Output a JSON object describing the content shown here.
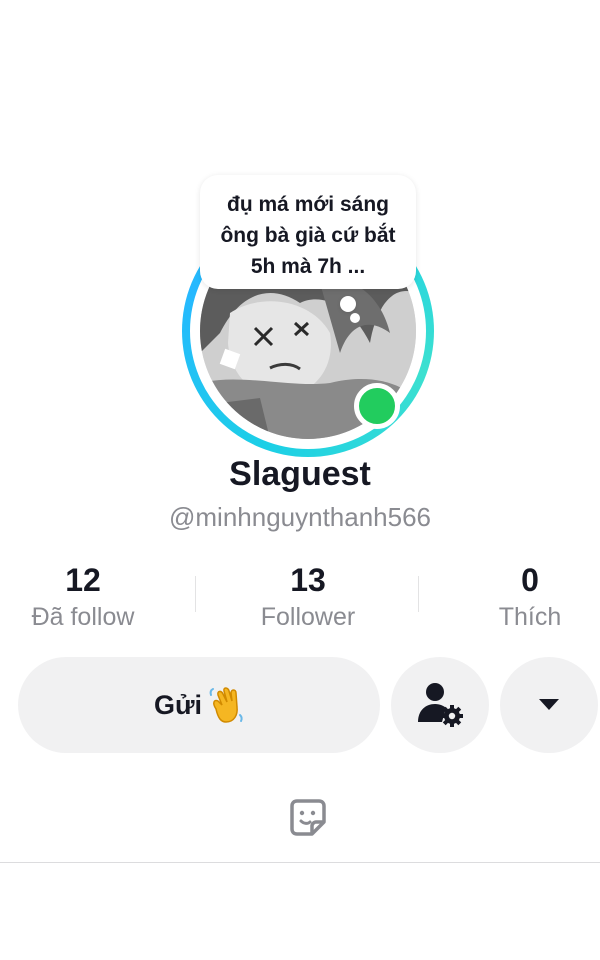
{
  "profile": {
    "note": "đụ má mới sáng ông bà già cứ bắt 5h mà 7h ...",
    "display_name": "Slaguest",
    "username": "@minhnguynthanh566",
    "online": true
  },
  "stats": [
    {
      "value": "12",
      "label": "Đã follow"
    },
    {
      "value": "13",
      "label": "Follower"
    },
    {
      "value": "0",
      "label": "Thích"
    }
  ],
  "actions": {
    "message_label": "Gửi",
    "message_icon": "waving-hand-icon",
    "settings_icon": "person-settings-icon",
    "more_icon": "triangle-down-icon"
  },
  "tabs": {
    "active_icon": "sticker-icon"
  },
  "colors": {
    "ring": "#1ccfe6",
    "online": "#22cc5e",
    "text_primary": "#161823",
    "text_secondary": "#8a8b91",
    "button_bg": "#f1f1f2"
  }
}
